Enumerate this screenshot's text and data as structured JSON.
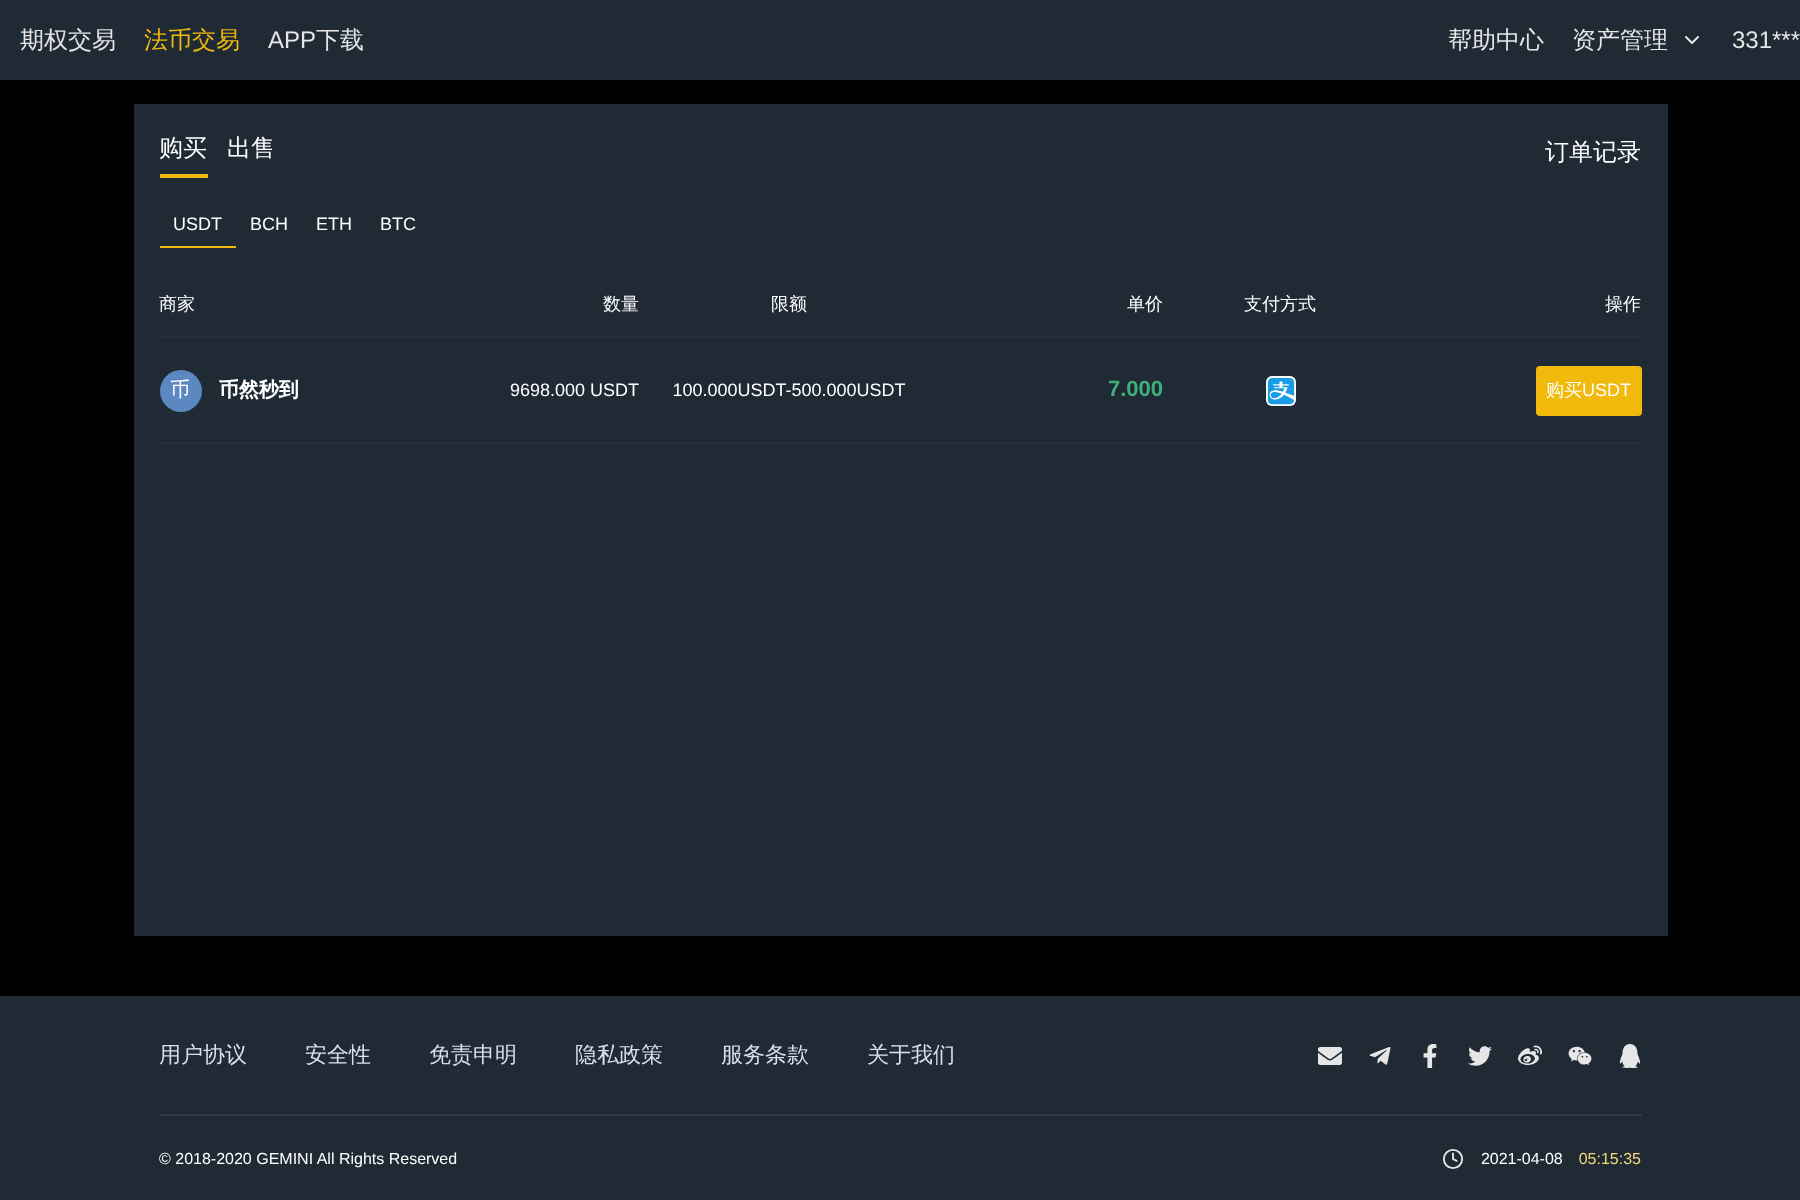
{
  "nav": {
    "links": [
      {
        "label": "期权交易",
        "selected": false
      },
      {
        "label": "法币交易",
        "selected": true
      },
      {
        "label": "APP下载",
        "selected": false
      }
    ],
    "right": [
      {
        "kind": "link",
        "label": "帮助中心"
      },
      {
        "kind": "dropdown",
        "label": "资产管理"
      },
      {
        "kind": "link",
        "label": "331***"
      }
    ]
  },
  "trade_tabs": [
    {
      "label": "购买",
      "selected": true
    },
    {
      "label": "出售",
      "selected": false
    }
  ],
  "order_history": "订单记录",
  "coins": [
    {
      "label": "USDT",
      "selected": true
    },
    {
      "label": "BCH",
      "selected": false
    },
    {
      "label": "ETH",
      "selected": false
    },
    {
      "label": "BTC",
      "selected": false
    }
  ],
  "table": {
    "columns": [
      "商家",
      "数量",
      "限额",
      "单价",
      "支付方式",
      "操作"
    ],
    "rows": [
      {
        "avatar": "币",
        "merchant": "币然秒到",
        "amount": "9698.000 USDT",
        "limit": "100.000USDT-500.000USDT",
        "price": "7.000",
        "action": "购买USDT"
      }
    ]
  },
  "footer": {
    "links": [
      "用户协议",
      "安全性",
      "免责申明",
      "隐私政策",
      "服务条款",
      "关于我们"
    ],
    "copyright": "© 2018-2020 GEMINI All Rights Reserved",
    "date": "2021-04-08",
    "time": "05:15:35"
  }
}
